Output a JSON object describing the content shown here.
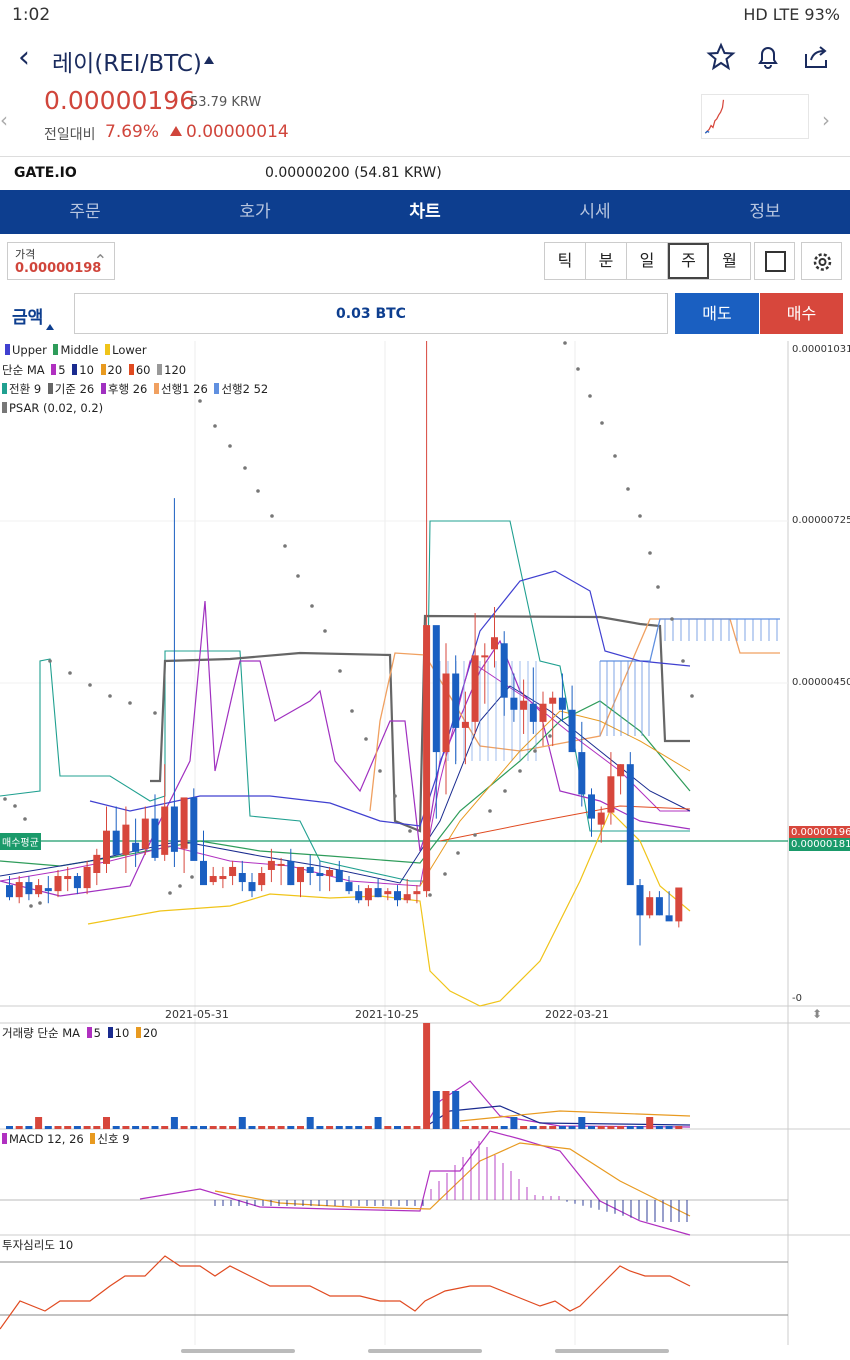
{
  "status_bar": {
    "time": "1:02",
    "indicators": "HD LTE 93%"
  },
  "header": {
    "title": "레이(REI/BTC)"
  },
  "price": {
    "current": "0.00000196",
    "krw": "53.79 KRW",
    "change_label": "전일대비",
    "change_pct": "7.69%",
    "change_abs": "0.00000014"
  },
  "exchange": {
    "name": "GATE.IO",
    "price": "0.00000200 (54.81 KRW)"
  },
  "tabs": [
    "주문",
    "호가",
    "차트",
    "시세",
    "정보"
  ],
  "active_tab": "차트",
  "toolbar": {
    "price_label": "가격",
    "price_value": "0.00000198",
    "periods": [
      "틱",
      "분",
      "일",
      "주",
      "월"
    ],
    "active_period": "주"
  },
  "order": {
    "amount_label": "금액",
    "amount_value": "0.03 BTC",
    "sell": "매도",
    "buy": "매수"
  },
  "legends": {
    "bb": [
      "Upper",
      "Middle",
      "Lower"
    ],
    "ma_title": "단순 MA",
    "ma": [
      "5",
      "10",
      "20",
      "60",
      "120"
    ],
    "ichimoku": [
      "전환 9",
      "기준 26",
      "후행 26",
      "선행1 26",
      "선행2 52"
    ],
    "psar": "PSAR (0.02, 0.2)",
    "volume_title": "거래량 단순 MA",
    "volume_ma": [
      "5",
      "10",
      "20"
    ],
    "macd": "MACD 12, 26",
    "macd_signal": "신호 9",
    "psych": "투자심리도 10"
  },
  "colors": {
    "up": "#d7473c",
    "down": "#1a5fc1",
    "bb_upper": "#4040d0",
    "bb_middle": "#2e9c5a",
    "bb_lower": "#f0c419",
    "ma5": "#b030c0",
    "ma10": "#1a2b8f",
    "ma20": "#e89a20",
    "ma60": "#e04a20",
    "ma120": "#999999",
    "ich_conv": "#20a090",
    "ich_base": "#666666",
    "ich_lag": "#a030c0",
    "ich_span1": "#f0a060",
    "ich_span2": "#6090e0",
    "psar": "#777777",
    "avg_buy": "#1a9a6a",
    "header_blue": "#0d3e8f"
  },
  "chart_data": {
    "type": "candlestick",
    "x_labels": [
      "2021-05-31",
      "2021-10-25",
      "2022-03-21"
    ],
    "y_labels": [
      "0.00001031",
      "0.00000725",
      "0.00000450",
      "-0"
    ],
    "avg_buy_label": "매수평균",
    "current_label": "0.00000196",
    "avg_buy_value": "0.00000181",
    "ohlc": [
      [
        200,
        215,
        175,
        180
      ],
      [
        180,
        215,
        170,
        205
      ],
      [
        205,
        215,
        175,
        185
      ],
      [
        185,
        210,
        180,
        200
      ],
      [
        195,
        215,
        170,
        190
      ],
      [
        190,
        225,
        180,
        215
      ],
      [
        210,
        230,
        190,
        215
      ],
      [
        215,
        220,
        185,
        195
      ],
      [
        195,
        240,
        185,
        230
      ],
      [
        220,
        260,
        200,
        250
      ],
      [
        235,
        330,
        220,
        290
      ],
      [
        290,
        330,
        250,
        250
      ],
      [
        250,
        330,
        220,
        300
      ],
      [
        270,
        310,
        230,
        255
      ],
      [
        260,
        330,
        250,
        310
      ],
      [
        310,
        350,
        240,
        245
      ],
      [
        250,
        400,
        240,
        330
      ],
      [
        330,
        840,
        230,
        255
      ],
      [
        260,
        330,
        220,
        345
      ],
      [
        345,
        360,
        250,
        240
      ],
      [
        240,
        290,
        210,
        200
      ],
      [
        205,
        230,
        200,
        215
      ],
      [
        210,
        230,
        195,
        215
      ],
      [
        215,
        240,
        200,
        230
      ],
      [
        220,
        240,
        190,
        205
      ],
      [
        205,
        220,
        180,
        190
      ],
      [
        200,
        230,
        190,
        220
      ],
      [
        225,
        260,
        205,
        240
      ],
      [
        235,
        245,
        200,
        235
      ],
      [
        240,
        260,
        200,
        200
      ],
      [
        205,
        230,
        180,
        230
      ],
      [
        230,
        250,
        200,
        220
      ],
      [
        220,
        240,
        190,
        215
      ],
      [
        215,
        230,
        190,
        225
      ],
      [
        225,
        240,
        210,
        205
      ],
      [
        205,
        215,
        185,
        190
      ],
      [
        190,
        200,
        170,
        175
      ],
      [
        175,
        200,
        165,
        195
      ],
      [
        195,
        210,
        180,
        180
      ],
      [
        185,
        195,
        175,
        190
      ],
      [
        190,
        200,
        165,
        175
      ],
      [
        175,
        210,
        170,
        185
      ],
      [
        185,
        200,
        170,
        190
      ],
      [
        190,
        1100,
        180,
        630
      ],
      [
        630,
        620,
        310,
        420
      ],
      [
        420,
        600,
        350,
        550
      ],
      [
        550,
        580,
        400,
        460
      ],
      [
        460,
        520,
        400,
        470
      ],
      [
        470,
        650,
        450,
        580
      ],
      [
        580,
        600,
        500,
        580
      ],
      [
        590,
        660,
        560,
        610
      ],
      [
        600,
        620,
        480,
        510
      ],
      [
        510,
        550,
        470,
        490
      ],
      [
        490,
        540,
        450,
        505
      ],
      [
        500,
        560,
        450,
        470
      ],
      [
        470,
        520,
        430,
        500
      ],
      [
        500,
        520,
        430,
        510
      ],
      [
        510,
        550,
        470,
        490
      ],
      [
        490,
        530,
        440,
        420
      ],
      [
        420,
        470,
        330,
        350
      ],
      [
        350,
        360,
        280,
        310
      ],
      [
        300,
        330,
        270,
        320
      ],
      [
        320,
        420,
        300,
        380
      ],
      [
        380,
        400,
        350,
        400
      ],
      [
        400,
        420,
        300,
        200
      ],
      [
        200,
        210,
        100,
        150
      ],
      [
        150,
        190,
        145,
        180
      ],
      [
        180,
        190,
        150,
        150
      ],
      [
        150,
        190,
        150,
        140
      ],
      [
        140,
        150,
        130,
        196
      ]
    ]
  }
}
